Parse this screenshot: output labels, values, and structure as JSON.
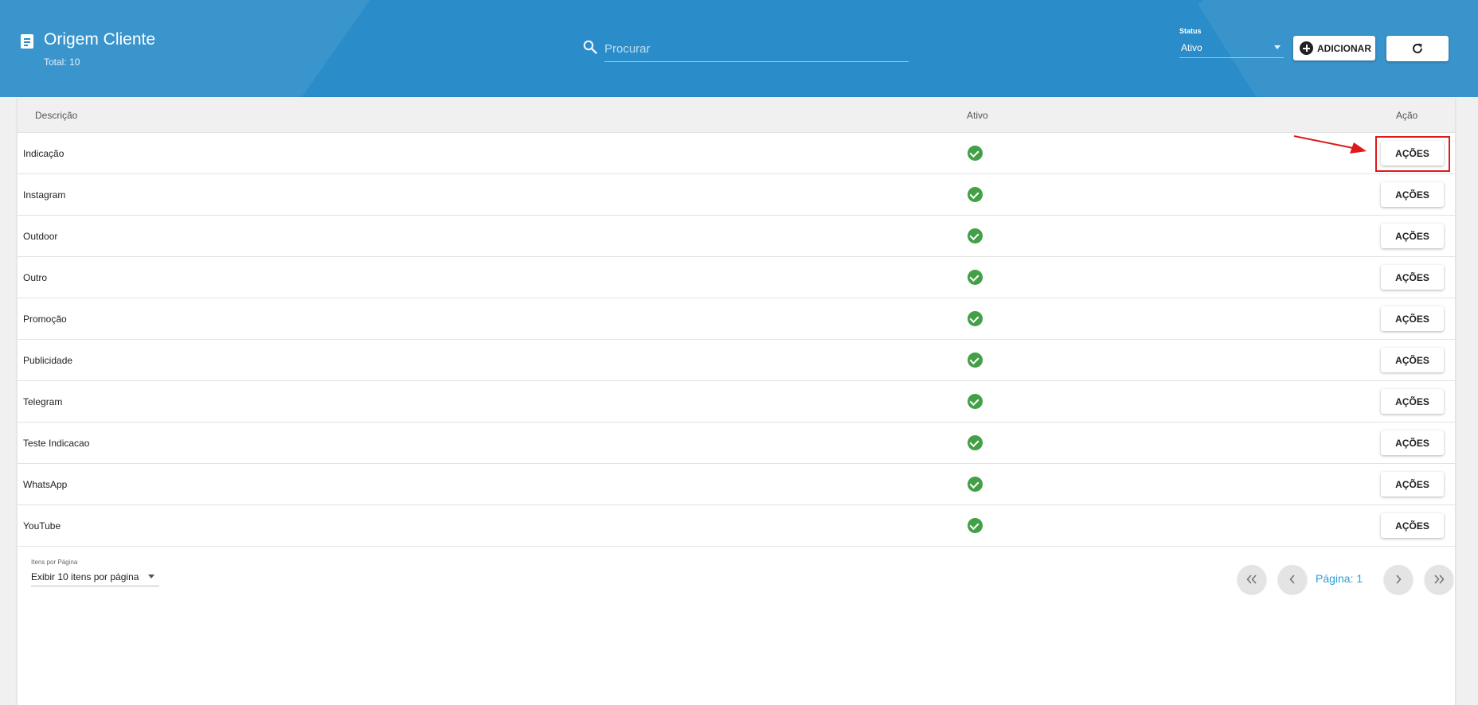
{
  "header": {
    "title": "Origem Cliente",
    "total": "Total: 10",
    "search_placeholder": "Procurar",
    "status_label": "Status",
    "status_value": "Ativo",
    "add_label": "ADICIONAR"
  },
  "table": {
    "columns": [
      "Descrição",
      "Ativo",
      "Ação"
    ],
    "action_label": "AÇÕES",
    "rows": [
      {
        "descricao": "Indicação",
        "ativo": true
      },
      {
        "descricao": "Instagram",
        "ativo": true
      },
      {
        "descricao": "Outdoor",
        "ativo": true
      },
      {
        "descricao": "Outro",
        "ativo": true
      },
      {
        "descricao": "Promoção",
        "ativo": true
      },
      {
        "descricao": "Publicidade",
        "ativo": true
      },
      {
        "descricao": "Telegram",
        "ativo": true
      },
      {
        "descricao": "Teste Indicacao",
        "ativo": true
      },
      {
        "descricao": "WhatsApp",
        "ativo": true
      },
      {
        "descricao": "YouTube",
        "ativo": true
      }
    ]
  },
  "pagination": {
    "items_per_page_label": "Itens por Página",
    "items_per_page_value": "Exibir 10 itens por página",
    "page_label": "Página: 1"
  },
  "colors": {
    "header_bg": "#2a8cc8",
    "active_check": "#43a047",
    "page_text": "#2a9fd8",
    "annotation": "#e0181a"
  }
}
